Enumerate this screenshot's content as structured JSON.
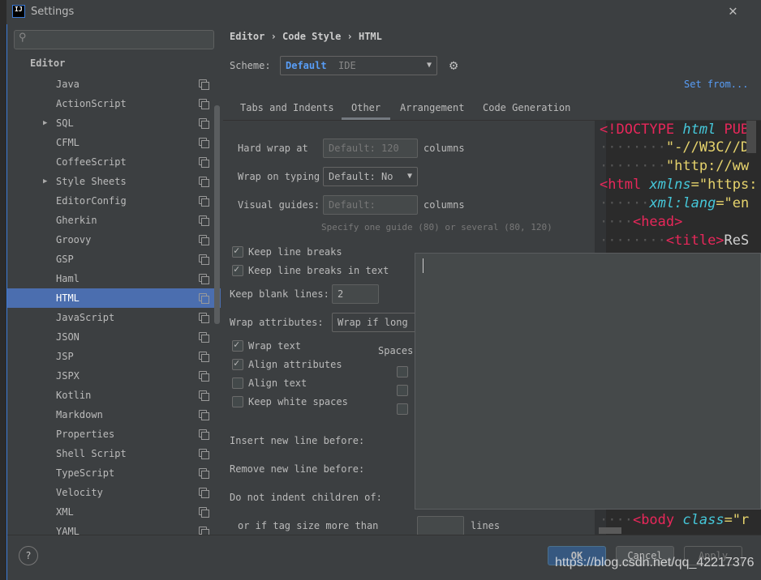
{
  "window": {
    "title": "Settings",
    "close_icon": "close-icon"
  },
  "search": {
    "placeholder": ""
  },
  "sidebar": {
    "section": "Editor",
    "items": [
      {
        "label": "Java"
      },
      {
        "label": "ActionScript"
      },
      {
        "label": "SQL",
        "expandable": true
      },
      {
        "label": "CFML"
      },
      {
        "label": "CoffeeScript"
      },
      {
        "label": "Style Sheets",
        "expandable": true
      },
      {
        "label": "EditorConfig"
      },
      {
        "label": "Gherkin"
      },
      {
        "label": "Groovy"
      },
      {
        "label": "GSP"
      },
      {
        "label": "Haml"
      },
      {
        "label": "HTML",
        "selected": true
      },
      {
        "label": "JavaScript"
      },
      {
        "label": "JSON"
      },
      {
        "label": "JSP"
      },
      {
        "label": "JSPX"
      },
      {
        "label": "Kotlin"
      },
      {
        "label": "Markdown"
      },
      {
        "label": "Properties"
      },
      {
        "label": "Shell Script"
      },
      {
        "label": "TypeScript"
      },
      {
        "label": "Velocity"
      },
      {
        "label": "XML"
      },
      {
        "label": "YAML"
      }
    ]
  },
  "breadcrumb": [
    "Editor",
    "Code Style",
    "HTML"
  ],
  "scheme": {
    "label": "Scheme:",
    "name": "Default",
    "type": "IDE",
    "set_from": "Set from..."
  },
  "tabs": [
    {
      "label": "Tabs and Indents"
    },
    {
      "label": "Other",
      "active": true
    },
    {
      "label": "Arrangement"
    },
    {
      "label": "Code Generation"
    }
  ],
  "options": {
    "hard_wrap_label": "Hard wrap at",
    "hard_wrap_placeholder": "Default: 120",
    "columns": "columns",
    "wrap_typing_label": "Wrap on typing",
    "wrap_typing_value": "Default: No",
    "visual_guides_label": "Visual guides:",
    "visual_guides_placeholder": "Default:",
    "guides_hint": "Specify one guide (80) or several (80, 120)",
    "keep_line_breaks": "Keep line breaks",
    "keep_line_breaks_text": "Keep line breaks in text",
    "keep_blank_label": "Keep blank lines:",
    "keep_blank_value": "2",
    "wrap_attr_label": "Wrap attributes:",
    "wrap_attr_value": "Wrap if long",
    "wrap_text": "Wrap text",
    "align_attributes": "Align attributes",
    "align_text": "Align text",
    "keep_white": "Keep white spaces",
    "spaces": "Spaces",
    "insert_before": "Insert new line before:",
    "remove_before": "Remove new line before:",
    "no_indent": "Do not indent children of:",
    "tag_size": "or if tag size more than",
    "lines": "lines"
  },
  "preview": {
    "lines": [
      [
        "<!DOCTYPE ",
        "html",
        " PUB"
      ],
      [
        "\"-//W3C//D"
      ],
      [
        "\"http://ww"
      ],
      [
        "<html ",
        "xmlns",
        "=\"https:"
      ],
      [
        "xml:lang",
        "=\"en"
      ],
      [
        "<head>"
      ],
      [
        "<title>",
        "ReS"
      ],
      [
        "<body ",
        "class",
        "=\"r"
      ]
    ]
  },
  "buttons": {
    "ok": "OK",
    "cancel": "Cancel",
    "apply": "Apply",
    "help": "?"
  },
  "watermark": "https://blog.csdn.net/qq_42217376"
}
